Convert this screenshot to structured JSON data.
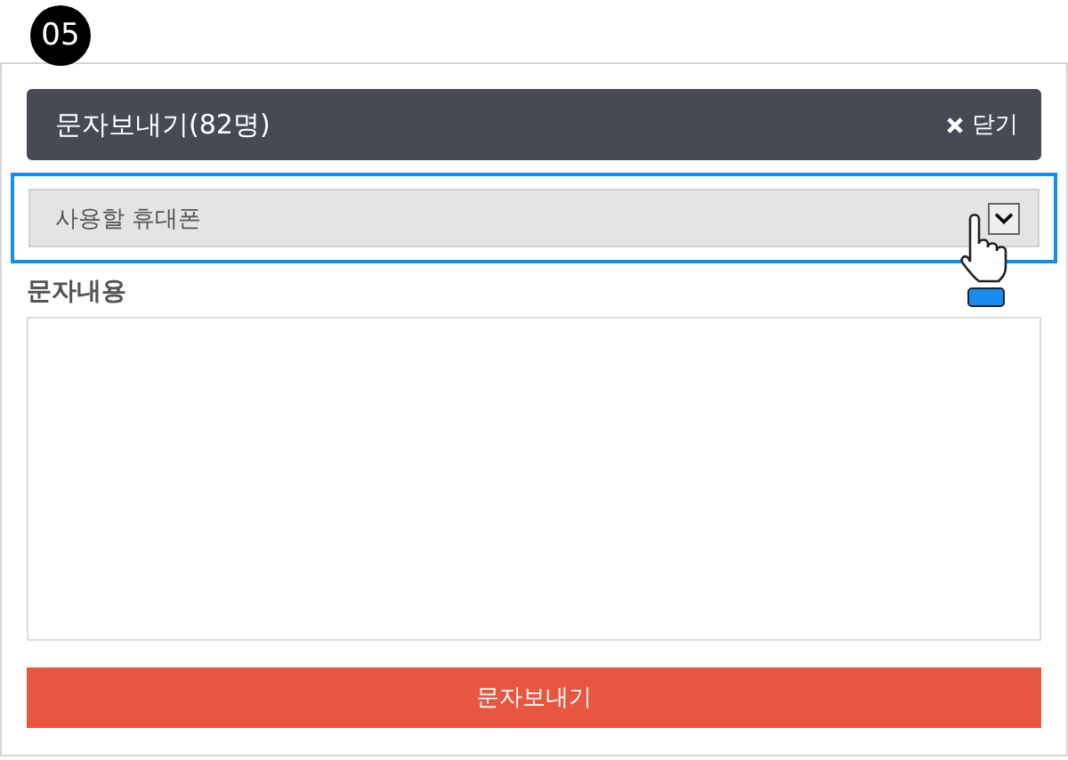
{
  "step": "05",
  "header": {
    "title": "문자보내기(82명)",
    "close_label": "닫기"
  },
  "phone_select": {
    "placeholder": "사용할 휴대폰",
    "highlighted": true
  },
  "message": {
    "label": "문자내용"
  },
  "send_button": {
    "label": "문자보내기"
  }
}
